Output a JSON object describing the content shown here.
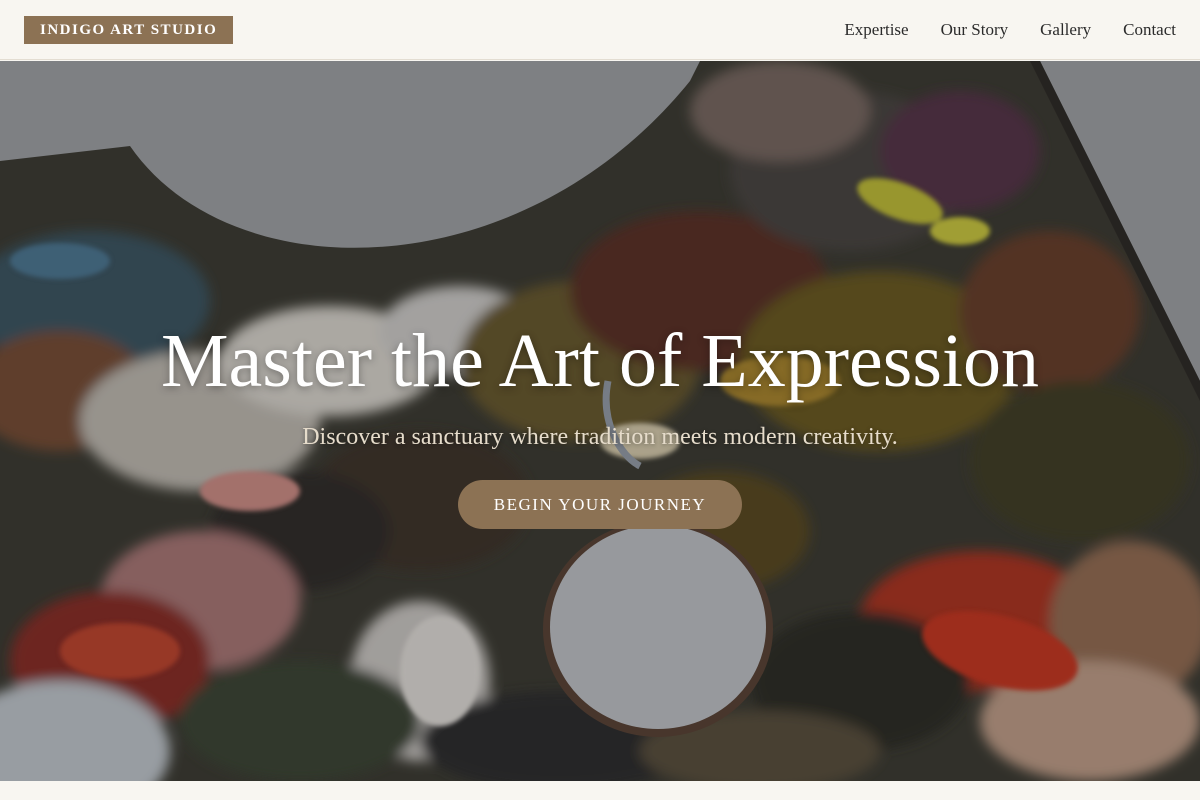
{
  "brand": {
    "name": "INDIGO ART STUDIO"
  },
  "nav": {
    "items": [
      {
        "label": "Expertise"
      },
      {
        "label": "Our Story"
      },
      {
        "label": "Gallery"
      },
      {
        "label": "Contact"
      }
    ]
  },
  "hero": {
    "title": "Master the Art of Expression",
    "subtitle": "Discover a sanctuary where tradition meets modern creativity.",
    "cta_label": "BEGIN YOUR JOURNEY",
    "background_image": "paint-palette-photo"
  },
  "colors": {
    "accent": "#8c7254",
    "page_background": "#f8f6f1",
    "nav_text": "#2b2b2b",
    "subtitle_text": "#e6dccb"
  }
}
